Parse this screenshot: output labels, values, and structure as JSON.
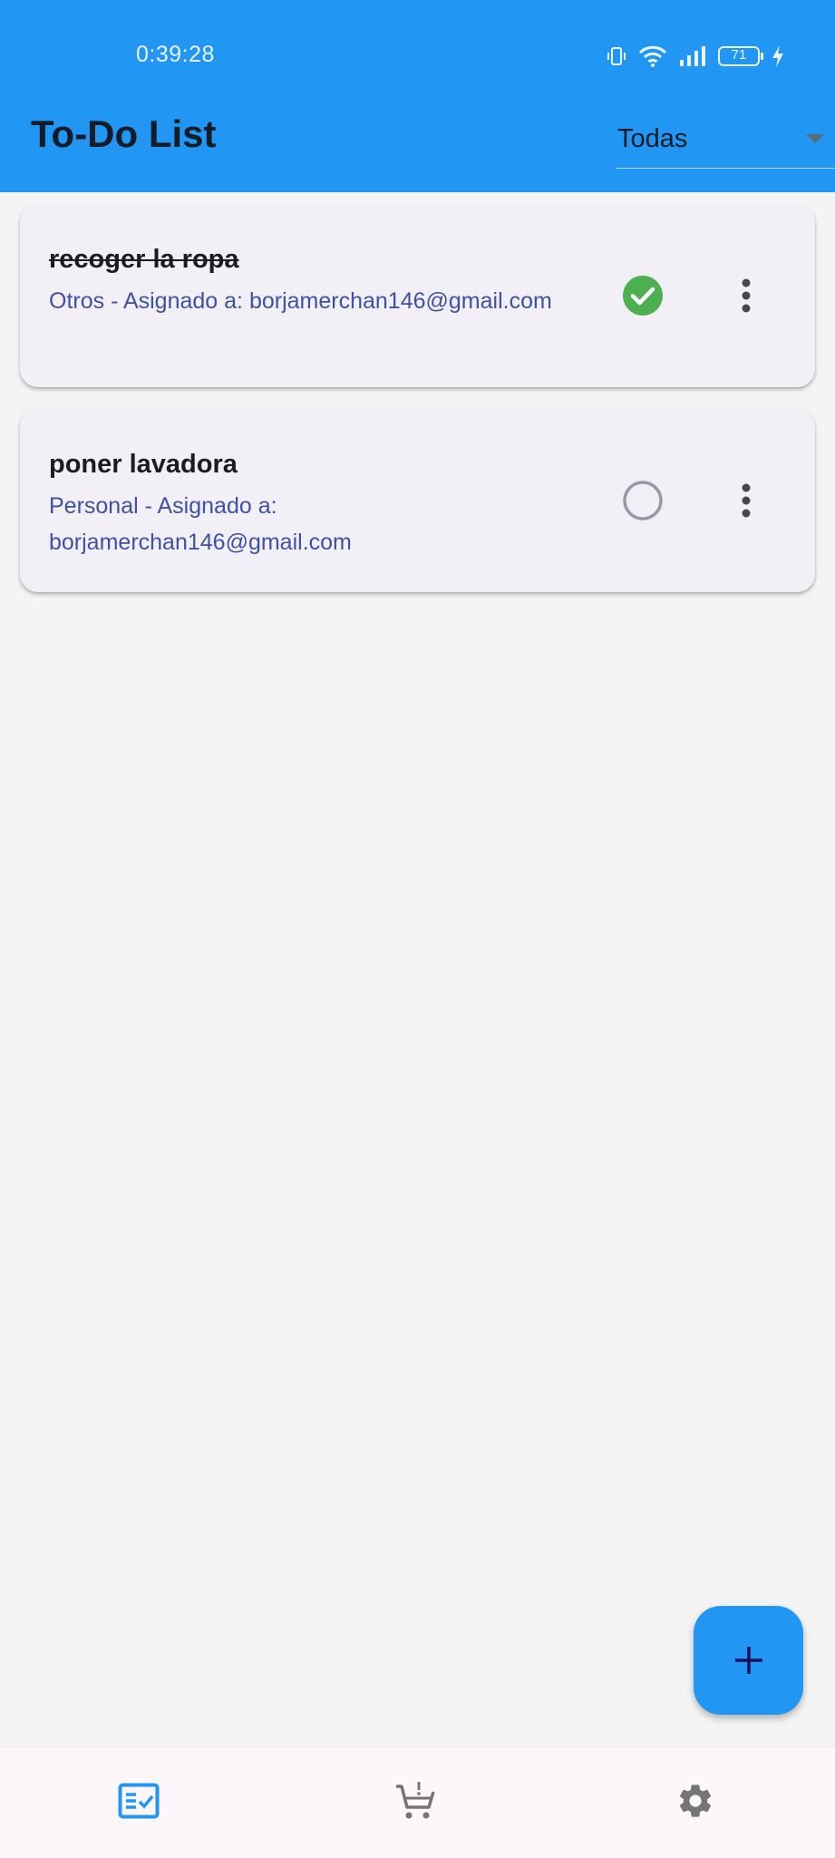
{
  "status_bar": {
    "time": "0:39:28",
    "battery": "71",
    "icons": [
      "vibrate-icon",
      "wifi-icon",
      "signal-icon",
      "battery-icon",
      "charging-icon"
    ]
  },
  "app_bar": {
    "title": "To-Do List",
    "filter": {
      "selected": "Todas"
    },
    "background": "#2196f3"
  },
  "tasks": [
    {
      "title": "recoger la ropa",
      "subtitle": "Otros - Asignado a: borjamerchan146@gmail.com",
      "completed": true
    },
    {
      "title": "poner lavadora",
      "subtitle": "Personal - Asignado a: borjamerchan146@gmail.com",
      "completed": false
    }
  ],
  "fab": {
    "icon": "plus-icon"
  },
  "bottom_nav": {
    "items": [
      {
        "icon": "task-list-icon",
        "active": true
      },
      {
        "icon": "cart-icon",
        "active": false
      },
      {
        "icon": "gear-icon",
        "active": false
      }
    ]
  },
  "colors": {
    "accent": "#2196f3",
    "done": "#4caf50",
    "subtitle": "#3f51a4",
    "card": "#f3eff6"
  }
}
